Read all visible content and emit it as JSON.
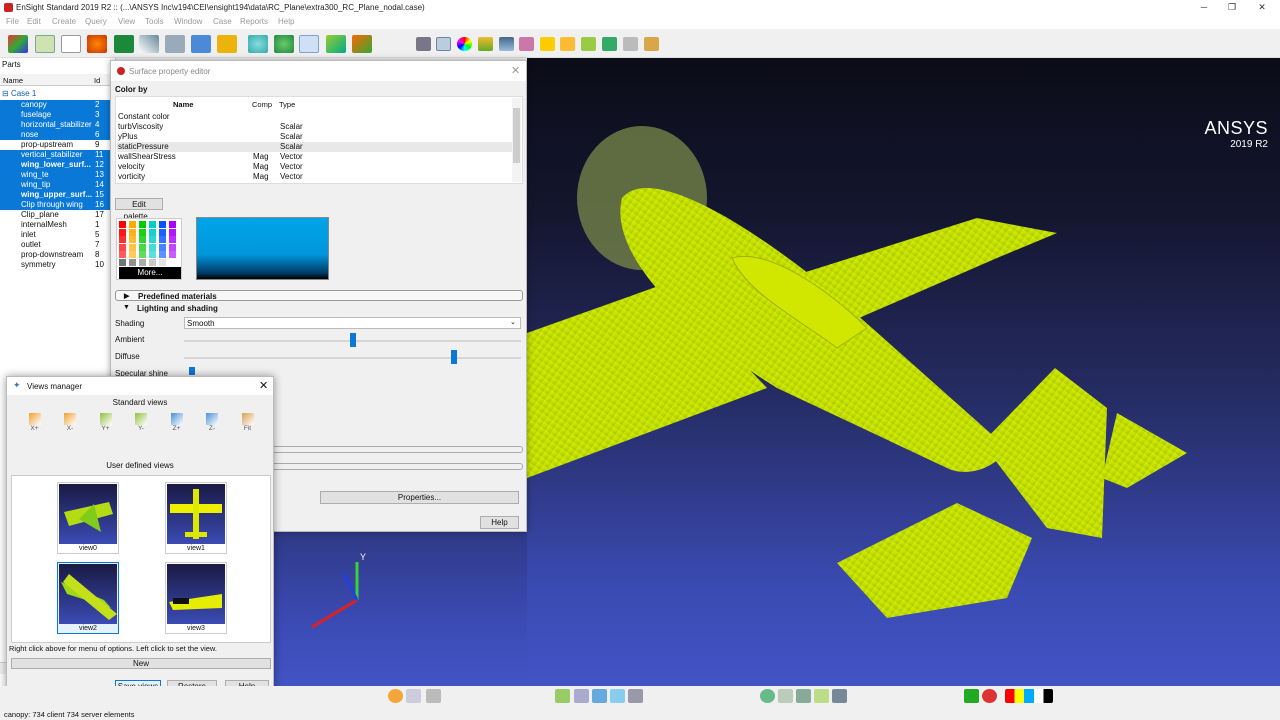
{
  "window": {
    "title": "EnSight Standard 2019 R2 :: (...\\ANSYS Inc\\v194\\CEI\\ensight194\\data\\RC_Plane\\extra300_RC_Plane_nodal.case)",
    "buttons": [
      "─",
      "❐",
      "✕"
    ]
  },
  "menu": [
    "File",
    "Edit",
    "Create",
    "Query",
    "View",
    "Tools",
    "Window",
    "Case",
    "Reports",
    "Help"
  ],
  "parts": {
    "panel_title": "Parts",
    "col_name": "Name",
    "col_id": "Id",
    "case_label": "Case 1",
    "items": [
      {
        "name": "canopy",
        "id": "2",
        "selected": true
      },
      {
        "name": "fuselage",
        "id": "3",
        "selected": true
      },
      {
        "name": "horizontal_stabilizer",
        "id": "4",
        "selected": true
      },
      {
        "name": "nose",
        "id": "6",
        "selected": true
      },
      {
        "name": "prop-upstream",
        "id": "9",
        "selected": false
      },
      {
        "name": "vertical_stabilizer",
        "id": "11",
        "selected": true
      },
      {
        "name": "wing_lower_surf...",
        "id": "12",
        "selected": true
      },
      {
        "name": "wing_te",
        "id": "13",
        "selected": true
      },
      {
        "name": "wing_tip",
        "id": "14",
        "selected": true
      },
      {
        "name": "wing_upper_surf...",
        "id": "15",
        "selected": true
      },
      {
        "name": "Clip through wing",
        "id": "16",
        "selected": true
      },
      {
        "name": "Clip_plane",
        "id": "17",
        "selected": false
      },
      {
        "name": "internalMesh",
        "id": "1",
        "selected": false
      },
      {
        "name": "inlet",
        "id": "5",
        "selected": false
      },
      {
        "name": "outlet",
        "id": "7",
        "selected": false
      },
      {
        "name": "prop-downstream",
        "id": "8",
        "selected": false
      },
      {
        "name": "symmetry",
        "id": "10",
        "selected": false
      }
    ]
  },
  "surface_editor": {
    "title": "Surface property editor",
    "color_by": "Color by",
    "headers": {
      "name": "Name",
      "comp": "Comp",
      "type": "Type"
    },
    "rows": [
      {
        "name": "Constant color",
        "comp": "",
        "type": ""
      },
      {
        "name": "turbViscosity",
        "comp": "",
        "type": "Scalar"
      },
      {
        "name": "yPlus",
        "comp": "",
        "type": "Scalar"
      },
      {
        "name": "staticPressure",
        "comp": "",
        "type": "Scalar"
      },
      {
        "name": "wallShearStress",
        "comp": "Mag",
        "type": "Vector"
      },
      {
        "name": "velocity",
        "comp": "Mag",
        "type": "Vector"
      },
      {
        "name": "vorticity",
        "comp": "Mag",
        "type": "Vector"
      }
    ],
    "edit_palette": "Edit palette...",
    "more": "More...",
    "predefined_materials": "Predefined materials",
    "lighting_and_shading": "Lighting and shading",
    "shading_label": "Shading",
    "shading_value": "Smooth",
    "ambient_label": "Ambient",
    "ambient_value": 0.5,
    "diffuse_label": "Diffuse",
    "diffuse_value": 0.8,
    "specular_label": "Specular shine",
    "properties_button": "Properties...",
    "help_button": "Help"
  },
  "views_manager": {
    "title": "Views manager",
    "standard_views_label": "Standard views",
    "standard_views": [
      "X+",
      "X-",
      "Y+",
      "Y-",
      "Z+",
      "Z-",
      "Fit"
    ],
    "user_views_label": "User defined views",
    "user_views": [
      "view0",
      "view1",
      "view2",
      "view3"
    ],
    "hint": "Right click above for menu of options.  Left click to set the view.",
    "new_button": "New",
    "save_button": "Save views",
    "restore_button": "Restore views",
    "help_button": "Help"
  },
  "brand": {
    "name": "ANSYS",
    "version": "2019 R2"
  },
  "axis_label": "Y",
  "status": "canopy: 734 client 734 server elements",
  "colors": {
    "selection": "#0a78d7",
    "surface": "#c8e000",
    "background_top": "#0c0c18",
    "background_bottom": "#4254c4"
  }
}
